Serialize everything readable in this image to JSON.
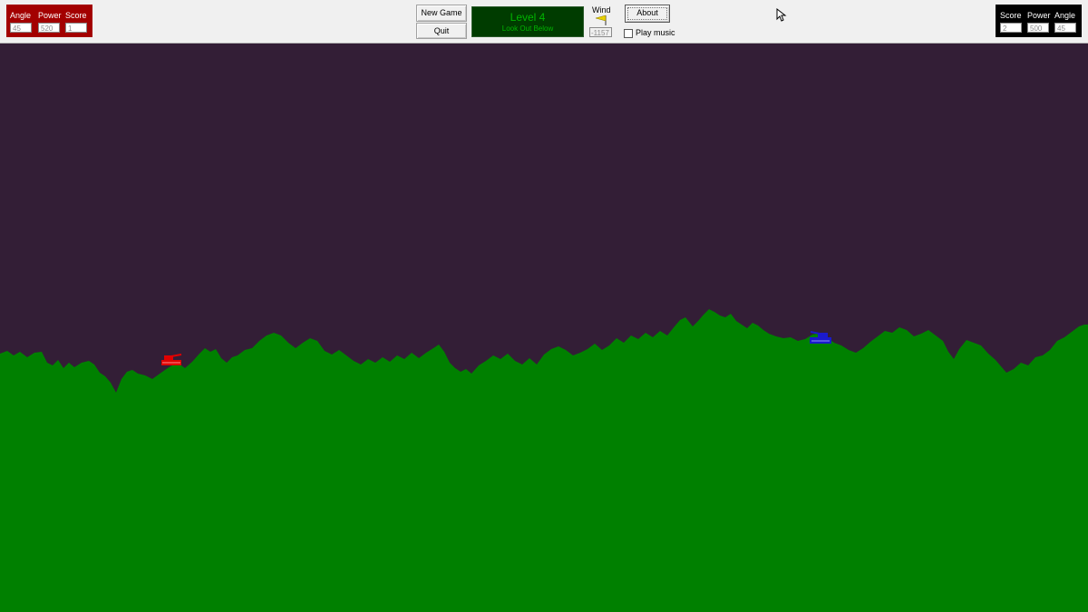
{
  "player1": {
    "angle_label": "Angle",
    "power_label": "Power",
    "score_label": "Score",
    "angle": "45",
    "power": "520",
    "score": "1",
    "color": "#a30000"
  },
  "player2": {
    "score_label": "Score",
    "power_label": "Power",
    "angle_label": "Angle",
    "score": "2",
    "power": "500",
    "angle": "45",
    "color": "#000000"
  },
  "controls": {
    "new_game": "New Game",
    "quit": "Quit",
    "about": "About",
    "wind_label": "Wind",
    "wind_value": "-1157",
    "play_music_label": "Play music",
    "play_music_checked": false
  },
  "level": {
    "title": "Level 4",
    "subtitle": "Look Out Below"
  },
  "game": {
    "sky_color": "#331e36",
    "ground_color": "#008000",
    "tanks": [
      {
        "player": 1,
        "color": "#e00000"
      },
      {
        "player": 2,
        "color": "#1a1acc"
      }
    ]
  },
  "icons": {
    "wind": "flag-icon",
    "cursor": "mouse-pointer-icon"
  }
}
